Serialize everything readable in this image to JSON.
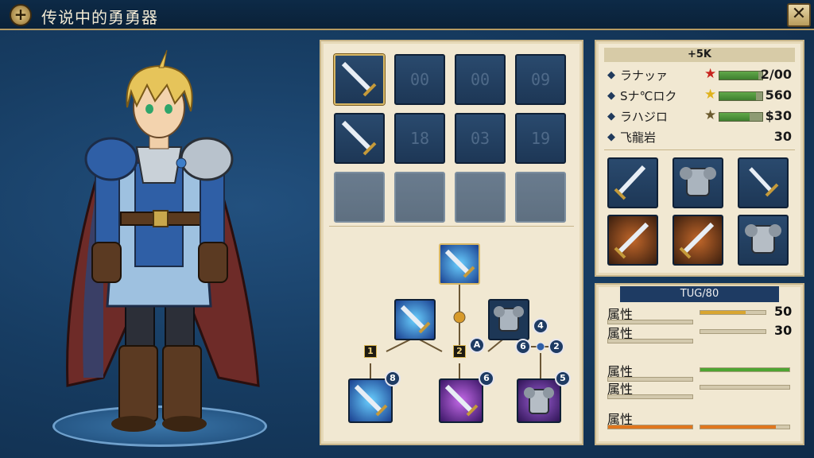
{
  "header": {
    "title": "传说中的勇勇器",
    "close_glyph": "✕",
    "menu_glyph": "+"
  },
  "inventory": {
    "slots": [
      {
        "kind": "sword",
        "selected": true,
        "label": ""
      },
      {
        "kind": "code",
        "label": "00"
      },
      {
        "kind": "code",
        "label": "00"
      },
      {
        "kind": "code",
        "label": "09"
      },
      {
        "kind": "sword",
        "selected": false,
        "label": ""
      },
      {
        "kind": "code",
        "label": "18"
      },
      {
        "kind": "code",
        "label": "03"
      },
      {
        "kind": "code",
        "label": "19"
      },
      {
        "kind": "empty",
        "label": ""
      },
      {
        "kind": "empty",
        "label": ""
      },
      {
        "kind": "empty",
        "label": ""
      },
      {
        "kind": "empty",
        "label": ""
      }
    ]
  },
  "tree": {
    "badges": {
      "a": "8",
      "b": "6",
      "c": "5",
      "d": "4",
      "e": "6",
      "f": "2",
      "g": "A"
    },
    "numboxes": {
      "one": "1",
      "two": "2"
    }
  },
  "stats": {
    "header": "+5K",
    "rows": [
      {
        "label": "ラナッァ",
        "star_color": "#c8241e",
        "bar_fill": 0.9,
        "value": "2/00"
      },
      {
        "label": "Sナ℃ロク",
        "star_color": "#e0b21c",
        "bar_fill": 0.85,
        "value": "560"
      },
      {
        "label": "ラハジロ",
        "star_color": "#6b5a2e",
        "bar_fill": 0.7,
        "value": "$30"
      },
      {
        "label": "飞龍岩",
        "star_color": "",
        "bar_fill": 0,
        "value": "30"
      }
    ]
  },
  "attributes": {
    "header": "TUG/80",
    "rows": [
      {
        "label": "属性",
        "value": "50",
        "right_fill": 0.7,
        "fill_color": "#d9a631"
      },
      {
        "label": "属性",
        "value": "30",
        "right_fill": 0,
        "fill_color": "#d9a631"
      },
      {
        "label": "属性",
        "value": "",
        "right_fill": 1.0,
        "fill_color": "#4ea532"
      },
      {
        "label": "属性",
        "value": "",
        "right_fill": 0,
        "fill_color": "#4ea532"
      },
      {
        "label": "属性",
        "value": "",
        "right_fill": 0.85,
        "fill_color": "#e0761e"
      }
    ]
  },
  "colors": {
    "accent_gold": "#d9b865",
    "panel_bg": "#f1e8d2",
    "navy": "#173d63"
  }
}
